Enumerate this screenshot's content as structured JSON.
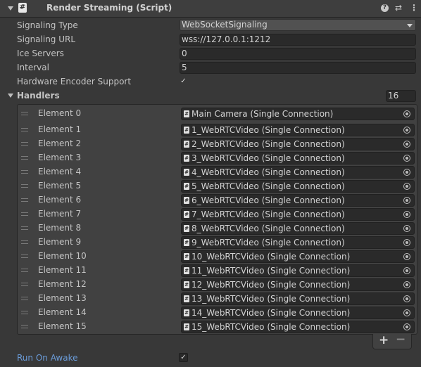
{
  "component": {
    "title": "Render Streaming (Script)",
    "icon": "script-icon",
    "header_icons": [
      "help-icon",
      "preset-icon",
      "kebab-menu-icon"
    ]
  },
  "fields": {
    "signaling_type_label": "Signaling Type",
    "signaling_type_value": "WebSocketSignaling",
    "signaling_url_label": "Signaling URL",
    "signaling_url_value": "wss://127.0.0.1:1212",
    "ice_servers_label": "Ice Servers",
    "ice_servers_value": "0",
    "interval_label": "Interval",
    "interval_value": "5",
    "hardware_label": "Hardware Encoder Support",
    "hardware_checked": true,
    "run_on_awake_label": "Run On Awake",
    "run_on_awake_checked": true
  },
  "handlers": {
    "label": "Handlers",
    "count": "16",
    "elements": [
      {
        "label": "Element 0",
        "value": "Main Camera (Single Connection)"
      },
      {
        "label": "Element 1",
        "value": "1_WebRTCVideo (Single Connection)"
      },
      {
        "label": "Element 2",
        "value": "2_WebRTCVideo (Single Connection)"
      },
      {
        "label": "Element 3",
        "value": "3_WebRTCVideo (Single Connection)"
      },
      {
        "label": "Element 4",
        "value": "4_WebRTCVideo (Single Connection)"
      },
      {
        "label": "Element 5",
        "value": "5_WebRTCVideo (Single Connection)"
      },
      {
        "label": "Element 6",
        "value": "6_WebRTCVideo (Single Connection)"
      },
      {
        "label": "Element 7",
        "value": "7_WebRTCVideo (Single Connection)"
      },
      {
        "label": "Element 8",
        "value": "8_WebRTCVideo (Single Connection)"
      },
      {
        "label": "Element 9",
        "value": "9_WebRTCVideo (Single Connection)"
      },
      {
        "label": "Element 10",
        "value": "10_WebRTCVideo (Single Connection)"
      },
      {
        "label": "Element 11",
        "value": "11_WebRTCVideo (Single Connection)"
      },
      {
        "label": "Element 12",
        "value": "12_WebRTCVideo (Single Connection)"
      },
      {
        "label": "Element 13",
        "value": "13_WebRTCVideo (Single Connection)"
      },
      {
        "label": "Element 14",
        "value": "14_WebRTCVideo (Single Connection)"
      },
      {
        "label": "Element 15",
        "value": "15_WebRTCVideo (Single Connection)"
      }
    ],
    "add_icon": "+",
    "remove_icon": "−"
  },
  "colors": {
    "background": "#383838",
    "field_bg": "#2a2a2a",
    "link_label": "#6a9bd8"
  }
}
